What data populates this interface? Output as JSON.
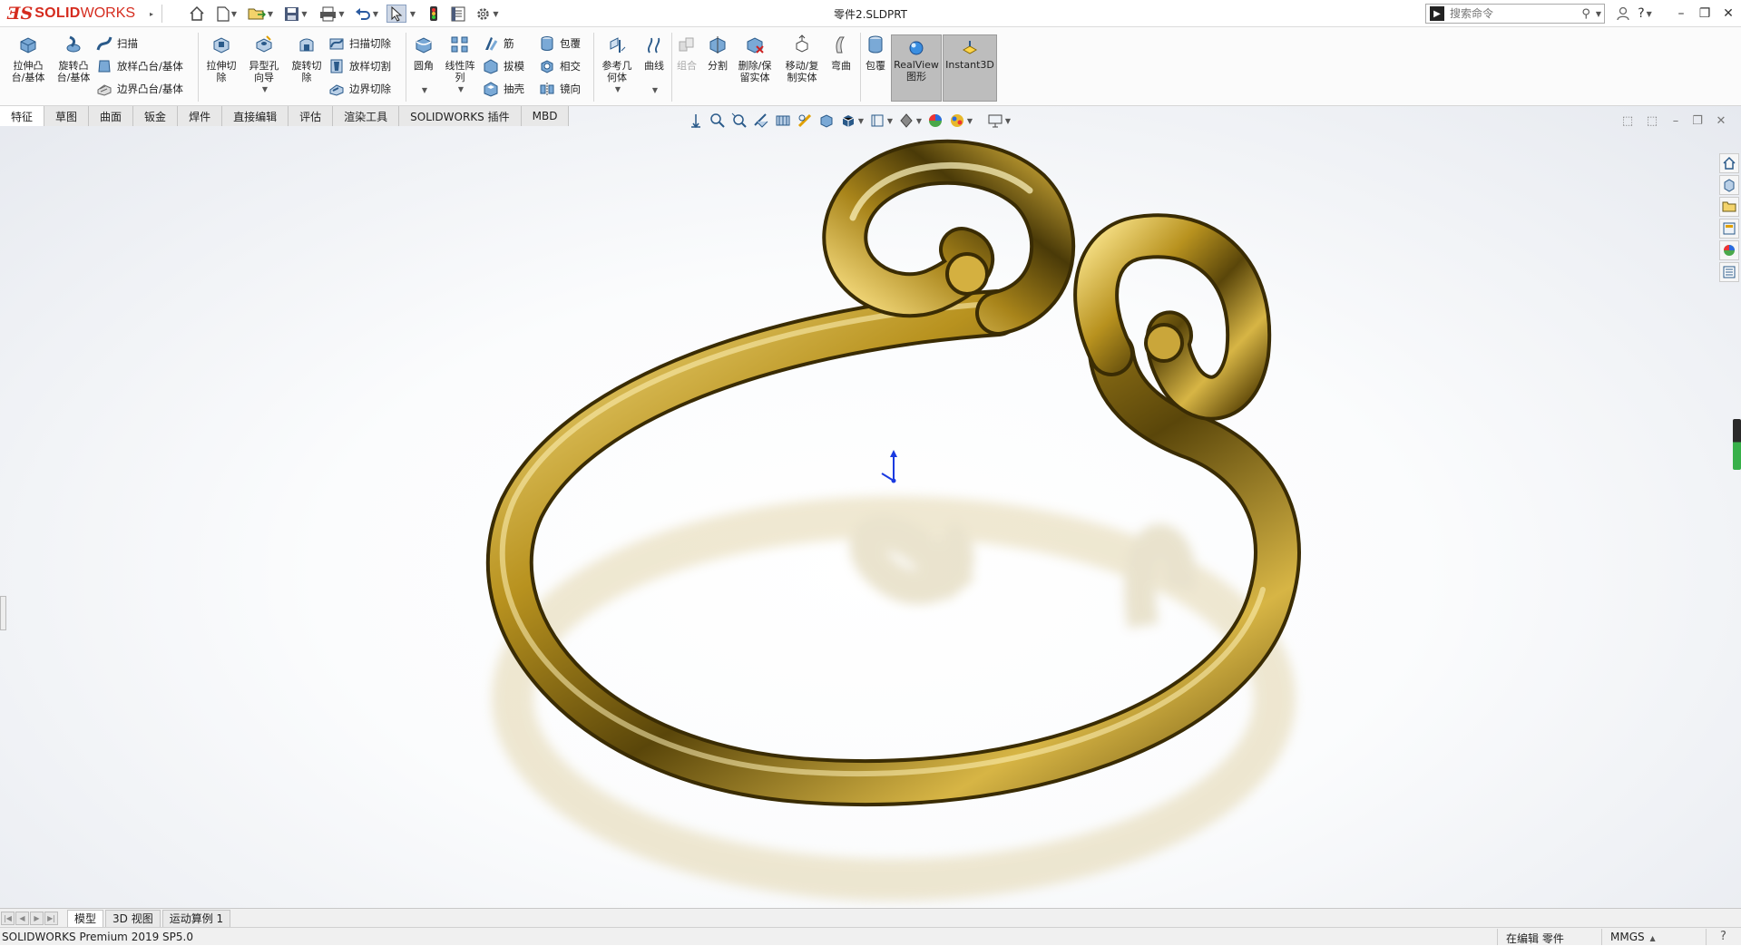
{
  "app": {
    "logo_ds": "ƎS",
    "logo_solid": "SOLID",
    "logo_works": "WORKS",
    "document_title": "零件2.SLDPRT"
  },
  "search": {
    "placeholder": "搜索命令"
  },
  "commands": {
    "extrude_boss": "拉伸凸\n台/基体",
    "revolve_boss": "旋转凸\n台/基体",
    "sweep": "扫描",
    "loft_boss": "放样凸台/基体",
    "boundary_boss": "边界凸台/基体",
    "extrude_cut": "拉伸切\n除",
    "hole_wizard": "异型孔\n向导",
    "revolve_cut": "旋转切\n除",
    "swept_cut": "扫描切除",
    "lofted_cut": "放样切割",
    "boundary_cut": "边界切除",
    "fillet": "圆角",
    "linear_pattern": "线性阵\n列",
    "rib": "筋",
    "draft": "拔模",
    "shell": "抽壳",
    "wrap": "包覆",
    "intersect": "相交",
    "mirror": "镜向",
    "reference_geometry": "参考几\n何体",
    "curves": "曲线",
    "combine": "组合",
    "split": "分割",
    "delete_keep_body": "删除/保\n留实体",
    "move_copy_body": "移动/复\n制实体",
    "flex": "弯曲",
    "wrap2": "包覆",
    "realview": "RealView\n图形",
    "instant3d": "Instant3D"
  },
  "tabs": [
    "特征",
    "草图",
    "曲面",
    "钣金",
    "焊件",
    "直接编辑",
    "评估",
    "渲染工具",
    "SOLIDWORKS 插件",
    "MBD"
  ],
  "active_tab": "特征",
  "bottom_tabs": [
    "模型",
    "3D 视图",
    "运动算例 1"
  ],
  "active_bottom_tab": "模型",
  "status": {
    "product": "SOLIDWORKS Premium 2019 SP5.0",
    "mode": "在编辑 零件",
    "units": "MMGS"
  },
  "colors": {
    "brand": "#d52b1e",
    "gold_light": "#f2d676",
    "gold_mid": "#b08d1e",
    "gold_dark": "#4a3a08"
  }
}
